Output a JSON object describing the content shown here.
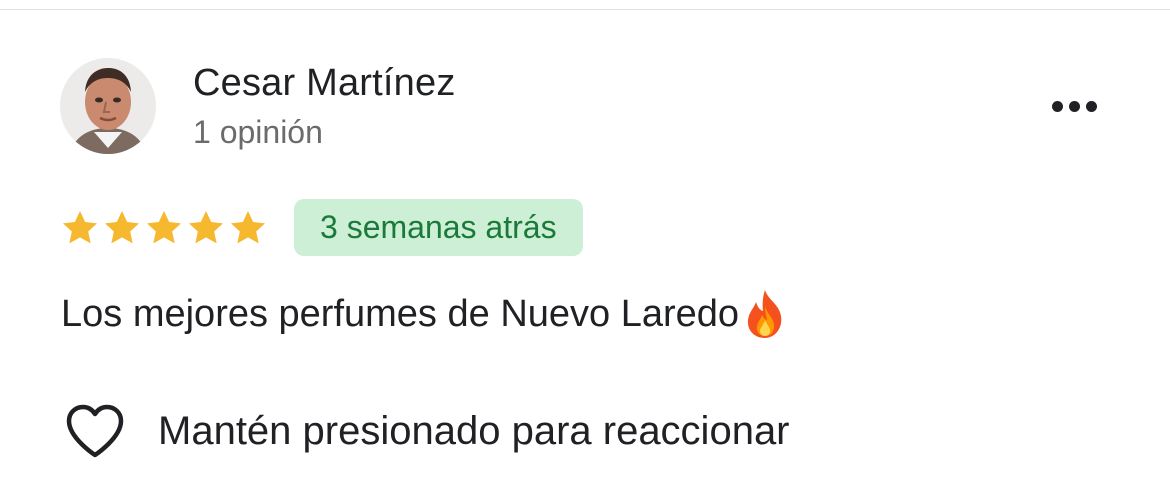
{
  "reviewer": {
    "name": "Cesar Martínez",
    "review_count": "1 opinión",
    "avatar": "avatar-photo"
  },
  "review": {
    "rating": 5,
    "rating_max": 5,
    "time_ago": "3 semanas atrás",
    "text": "Los mejores perfumes de Nuevo Laredo",
    "emoji": "🔥"
  },
  "actions": {
    "more_icon": "more-horizontal-icon",
    "react_icon": "heart-outline-icon",
    "react_label": "Mantén presionado para reaccionar"
  },
  "colors": {
    "star": "#F5B82E",
    "badge_bg": "#CDEFD6",
    "badge_text": "#1B7A3A",
    "text_primary": "#202124",
    "text_secondary": "#6B6B6B"
  }
}
